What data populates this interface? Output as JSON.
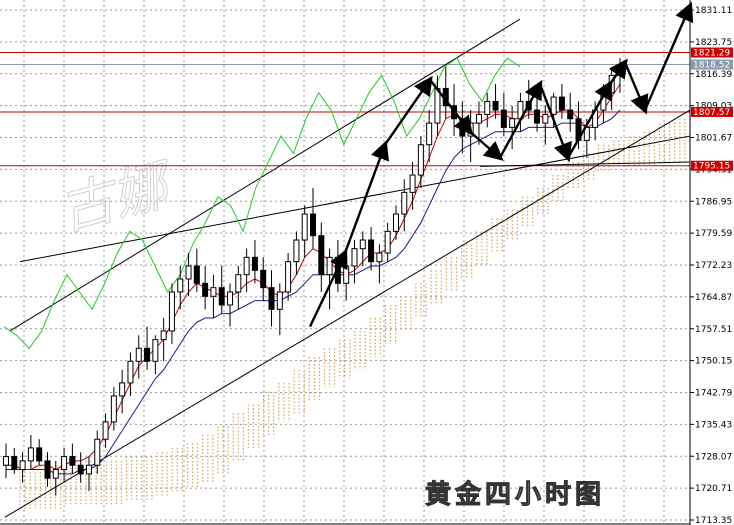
{
  "chart_data": {
    "type": "candlestick",
    "caption": "黄金四小时图",
    "watermark": "古娜",
    "grid": true,
    "ylim": [
      1713.35,
      1831.11
    ],
    "y_ticks": [
      "1831.11",
      "1823.75",
      "1816.39",
      "1809.03",
      "1801.67",
      "1794.31",
      "1786.95",
      "1779.59",
      "1772.23",
      "1764.87",
      "1757.51",
      "1750.15",
      "1742.79",
      "1735.43",
      "1728.07",
      "1720.71",
      "1713.35"
    ],
    "horizontal_levels": [
      {
        "value": 1821.29,
        "label": "1821.29",
        "color": "#cc0000"
      },
      {
        "value": 1818.52,
        "label": "1818.52",
        "color": "#8a9bb0"
      },
      {
        "value": 1807.57,
        "label": "1807.57",
        "color": "#cc0000"
      },
      {
        "value": 1795.15,
        "label": "1795.15",
        "color": "#cc0000"
      }
    ],
    "candles_ohlc": [
      [
        1726,
        1731,
        1723,
        1728
      ],
      [
        1728,
        1730,
        1724,
        1725
      ],
      [
        1725,
        1729,
        1722,
        1727
      ],
      [
        1727,
        1733,
        1725,
        1730
      ],
      [
        1730,
        1732,
        1726,
        1727
      ],
      [
        1727,
        1729,
        1721,
        1723
      ],
      [
        1723,
        1727,
        1719,
        1725
      ],
      [
        1725,
        1730,
        1722,
        1728
      ],
      [
        1728,
        1731,
        1724,
        1726
      ],
      [
        1726,
        1729,
        1722,
        1724
      ],
      [
        1724,
        1728,
        1720,
        1726
      ],
      [
        1726,
        1734,
        1724,
        1732
      ],
      [
        1732,
        1738,
        1730,
        1736
      ],
      [
        1736,
        1744,
        1734,
        1742
      ],
      [
        1742,
        1748,
        1738,
        1745
      ],
      [
        1745,
        1752,
        1742,
        1750
      ],
      [
        1750,
        1756,
        1746,
        1753
      ],
      [
        1753,
        1758,
        1748,
        1750
      ],
      [
        1750,
        1756,
        1747,
        1755
      ],
      [
        1755,
        1760,
        1750,
        1757
      ],
      [
        1757,
        1768,
        1754,
        1766
      ],
      [
        1766,
        1772,
        1762,
        1769
      ],
      [
        1769,
        1775,
        1765,
        1772
      ],
      [
        1772,
        1776,
        1766,
        1768
      ],
      [
        1768,
        1772,
        1762,
        1765
      ],
      [
        1765,
        1770,
        1760,
        1767
      ],
      [
        1767,
        1772,
        1761,
        1763
      ],
      [
        1763,
        1768,
        1758,
        1766
      ],
      [
        1766,
        1772,
        1762,
        1770
      ],
      [
        1770,
        1776,
        1766,
        1774
      ],
      [
        1774,
        1778,
        1768,
        1771
      ],
      [
        1771,
        1774,
        1764,
        1767
      ],
      [
        1767,
        1771,
        1758,
        1762
      ],
      [
        1762,
        1768,
        1756,
        1766
      ],
      [
        1766,
        1775,
        1764,
        1773
      ],
      [
        1773,
        1780,
        1770,
        1778
      ],
      [
        1778,
        1786,
        1774,
        1784
      ],
      [
        1784,
        1790,
        1776,
        1779
      ],
      [
        1779,
        1782,
        1766,
        1770
      ],
      [
        1770,
        1776,
        1762,
        1774
      ],
      [
        1774,
        1778,
        1766,
        1768
      ],
      [
        1768,
        1774,
        1764,
        1772
      ],
      [
        1772,
        1778,
        1768,
        1776
      ],
      [
        1776,
        1780,
        1772,
        1778
      ],
      [
        1778,
        1781,
        1771,
        1773
      ],
      [
        1773,
        1777,
        1768,
        1775
      ],
      [
        1775,
        1782,
        1773,
        1780
      ],
      [
        1780,
        1786,
        1778,
        1784
      ],
      [
        1784,
        1792,
        1780,
        1789
      ],
      [
        1789,
        1796,
        1785,
        1793
      ],
      [
        1793,
        1802,
        1790,
        1800
      ],
      [
        1800,
        1808,
        1796,
        1805
      ],
      [
        1805,
        1816,
        1802,
        1813
      ],
      [
        1813,
        1818,
        1806,
        1809
      ],
      [
        1809,
        1814,
        1802,
        1806
      ],
      [
        1806,
        1810,
        1798,
        1802
      ],
      [
        1802,
        1808,
        1796,
        1805
      ],
      [
        1805,
        1810,
        1800,
        1807
      ],
      [
        1807,
        1812,
        1804,
        1810
      ],
      [
        1810,
        1814,
        1806,
        1808
      ],
      [
        1808,
        1812,
        1802,
        1804
      ],
      [
        1804,
        1809,
        1799,
        1806
      ],
      [
        1806,
        1812,
        1803,
        1810
      ],
      [
        1810,
        1815,
        1806,
        1808
      ],
      [
        1808,
        1812,
        1803,
        1805
      ],
      [
        1805,
        1809,
        1800,
        1807
      ],
      [
        1807,
        1812,
        1804,
        1811
      ],
      [
        1811,
        1814,
        1806,
        1808
      ],
      [
        1808,
        1812,
        1803,
        1806
      ],
      [
        1806,
        1810,
        1799,
        1801
      ],
      [
        1801,
        1806,
        1797,
        1804
      ],
      [
        1804,
        1810,
        1801,
        1808
      ],
      [
        1808,
        1814,
        1805,
        1812
      ],
      [
        1812,
        1818,
        1808,
        1816
      ],
      [
        1816,
        1820,
        1812,
        1818
      ]
    ],
    "conversion_line": [
      1726,
      1726,
      1725,
      1725,
      1726,
      1726,
      1725,
      1726,
      1727,
      1727,
      1728,
      1730,
      1733,
      1737,
      1741,
      1745,
      1749,
      1751,
      1753,
      1755,
      1759,
      1763,
      1766,
      1768,
      1767,
      1766,
      1765,
      1765,
      1766,
      1768,
      1769,
      1768,
      1766,
      1765,
      1767,
      1770,
      1774,
      1776,
      1775,
      1773,
      1771,
      1770,
      1771,
      1773,
      1775,
      1775,
      1776,
      1779,
      1783,
      1787,
      1792,
      1797,
      1802,
      1806,
      1807,
      1806,
      1805,
      1805,
      1806,
      1807,
      1807,
      1806,
      1806,
      1807,
      1807,
      1806,
      1807,
      1808,
      1808,
      1806,
      1804,
      1805,
      1808,
      1811,
      1814
    ],
    "base_line": [
      1725,
      1725,
      1725,
      1725,
      1725,
      1725,
      1724,
      1724,
      1724,
      1725,
      1725,
      1726,
      1728,
      1731,
      1734,
      1737,
      1740,
      1743,
      1746,
      1748,
      1751,
      1754,
      1757,
      1759,
      1760,
      1760,
      1761,
      1761,
      1762,
      1763,
      1764,
      1764,
      1764,
      1764,
      1765,
      1766,
      1768,
      1770,
      1770,
      1770,
      1770,
      1770,
      1770,
      1771,
      1772,
      1772,
      1773,
      1774,
      1776,
      1779,
      1782,
      1786,
      1790,
      1794,
      1797,
      1799,
      1800,
      1801,
      1802,
      1803,
      1803,
      1803,
      1803,
      1804,
      1804,
      1804,
      1804,
      1805,
      1805,
      1805,
      1804,
      1804,
      1805,
      1806,
      1808
    ],
    "lagging_span": [
      1758,
      1756,
      1753,
      1757,
      1764,
      1770,
      1766,
      1762,
      1768,
      1775,
      1780,
      1778,
      1772,
      1766,
      1770,
      1777,
      1782,
      1788,
      1786,
      1780,
      1790,
      1796,
      1802,
      1798,
      1806,
      1812,
      1808,
      1800,
      1806,
      1812,
      1816,
      1810,
      1802,
      1806,
      1812,
      1818,
      1820,
      1814,
      1810,
      1816,
      1820,
      1818
    ],
    "cloud": [
      [
        1716,
        1726
      ],
      [
        1716,
        1726
      ],
      [
        1716,
        1726
      ],
      [
        1717,
        1727
      ],
      [
        1717,
        1727
      ],
      [
        1717,
        1727
      ],
      [
        1717,
        1727
      ],
      [
        1718,
        1728
      ],
      [
        1718,
        1728
      ],
      [
        1719,
        1729
      ],
      [
        1720,
        1730
      ],
      [
        1721,
        1731
      ],
      [
        1722,
        1733
      ],
      [
        1724,
        1735
      ],
      [
        1727,
        1738
      ],
      [
        1730,
        1740
      ],
      [
        1733,
        1743
      ],
      [
        1736,
        1745
      ],
      [
        1738,
        1748
      ],
      [
        1741,
        1751
      ],
      [
        1744,
        1753
      ],
      [
        1746,
        1755
      ],
      [
        1748,
        1757
      ],
      [
        1751,
        1760
      ],
      [
        1754,
        1763
      ],
      [
        1757,
        1765
      ],
      [
        1760,
        1768
      ],
      [
        1763,
        1771
      ],
      [
        1766,
        1774
      ],
      [
        1769,
        1777
      ],
      [
        1772,
        1780
      ],
      [
        1775,
        1783
      ],
      [
        1778,
        1785
      ],
      [
        1781,
        1788
      ],
      [
        1784,
        1790
      ],
      [
        1787,
        1793
      ],
      [
        1790,
        1796
      ],
      [
        1792,
        1798
      ],
      [
        1794,
        1800
      ],
      [
        1795,
        1801
      ],
      [
        1795,
        1802
      ],
      [
        1795,
        1803
      ],
      [
        1795,
        1805
      ],
      [
        1796,
        1806
      ],
      [
        1796,
        1806
      ]
    ],
    "forecast_path": [
      [
        310,
        1758
      ],
      [
        345,
        1775
      ],
      [
        385,
        1800
      ],
      [
        430,
        1815
      ],
      [
        470,
        1803
      ],
      [
        500,
        1797
      ],
      [
        540,
        1814
      ],
      [
        568,
        1797
      ],
      [
        610,
        1814
      ],
      [
        625,
        1819
      ],
      [
        645,
        1808
      ],
      [
        690,
        1832
      ]
    ],
    "trend_lines": [
      [
        [
          5,
          1714
        ],
        [
          690,
          1808
        ]
      ],
      [
        [
          10,
          1757
        ],
        [
          520,
          1829
        ]
      ],
      [
        [
          20,
          1773
        ],
        [
          690,
          1802
        ]
      ],
      [
        [
          480,
          1795
        ],
        [
          690,
          1796
        ]
      ]
    ]
  }
}
